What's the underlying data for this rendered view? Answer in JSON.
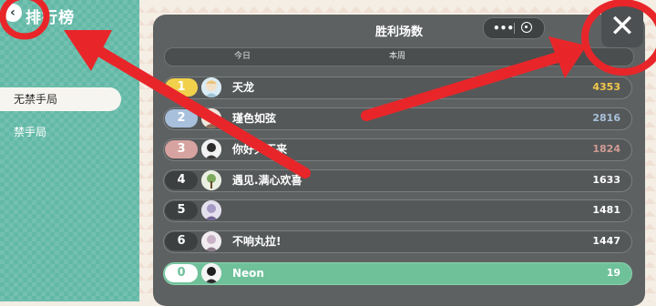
{
  "sidebar": {
    "back_icon": "chevron-left-icon",
    "title": "排行榜",
    "tabs": [
      {
        "label": "无禁手局",
        "active": true
      },
      {
        "label": "禁手局",
        "active": false
      }
    ]
  },
  "panel": {
    "title": "胜利场数",
    "filters": [
      {
        "label": "今日"
      },
      {
        "label": "本周"
      }
    ],
    "rows": [
      {
        "rank": "1",
        "name": "天龙",
        "score": "4353"
      },
      {
        "rank": "2",
        "name": "瑾色如弦",
        "score": "2816"
      },
      {
        "rank": "3",
        "name": "你好久不来",
        "score": "1824"
      },
      {
        "rank": "4",
        "name": "遇见.满心欢喜",
        "score": "1633"
      },
      {
        "rank": "5",
        "name": "",
        "score": "1481"
      },
      {
        "rank": "6",
        "name": "不响丸拉!",
        "score": "1447"
      }
    ],
    "self_row": {
      "rank": "0",
      "name": "Neon",
      "score": "19"
    }
  },
  "controls": {
    "menu_icon": "more-dots-icon",
    "target_icon": "target-icon",
    "close_icon": "close-icon"
  },
  "colors": {
    "sidebar": "#63b9a7",
    "panel": "#5e6162",
    "annotation_red": "#e8262a",
    "gold": "#f4c84a",
    "self_green": "#6fc19a"
  }
}
